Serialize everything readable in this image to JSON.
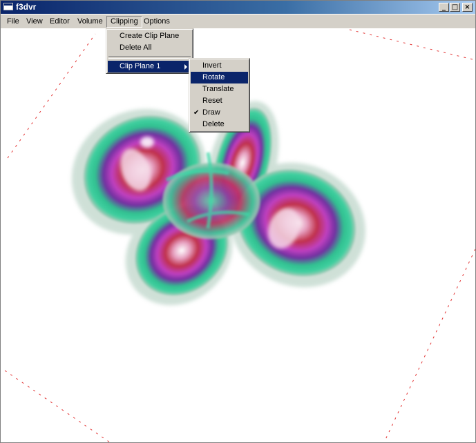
{
  "window": {
    "title": "f3dvr",
    "minimize_glyph": "_",
    "maximize_glyph": "□",
    "close_glyph": "×"
  },
  "menubar": {
    "items": [
      "File",
      "View",
      "Editor",
      "Volume",
      "Clipping",
      "Options"
    ],
    "active": "Clipping"
  },
  "clipping_menu": {
    "items": [
      "Create Clip Plane",
      "Delete All"
    ],
    "submenu_label": "Clip Plane 1"
  },
  "clip_plane_submenu": {
    "items": [
      "Invert",
      "Rotate",
      "Translate",
      "Reset",
      "Draw",
      "Delete"
    ],
    "highlighted": "Rotate",
    "checked": "Draw"
  },
  "colors": {
    "title_active": "#0a246a",
    "menu_highlight": "#0a246a",
    "clip_plane_outline": "#e23030"
  },
  "icons": [
    "app-icon",
    "minimize-icon",
    "maximize-icon",
    "close-icon",
    "chevron-right-icon",
    "check-icon"
  ]
}
